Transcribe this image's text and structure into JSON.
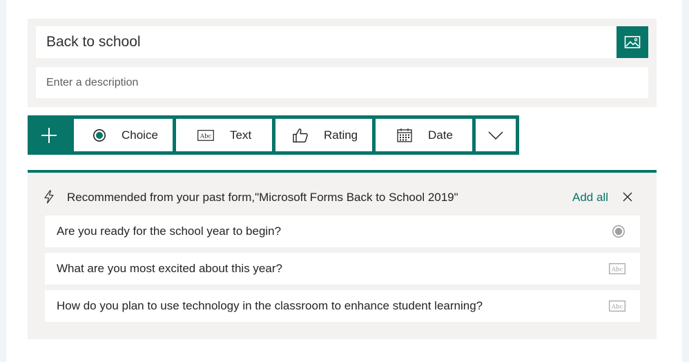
{
  "form": {
    "title": "Back to school",
    "description_placeholder": "Enter a description"
  },
  "toolbar": {
    "buttons": [
      {
        "label": "Choice",
        "icon": "radio-icon"
      },
      {
        "label": "Text",
        "icon": "abc-text-icon"
      },
      {
        "label": "Rating",
        "icon": "thumbs-up-icon"
      },
      {
        "label": "Date",
        "icon": "calendar-icon"
      }
    ]
  },
  "recommendations": {
    "header_text": "Recommended from your past form,\"Microsoft Forms Back to School 2019\"",
    "add_all_label": "Add all",
    "items": [
      {
        "text": "Are you ready for the school year to begin?",
        "type_icon": "radio-icon"
      },
      {
        "text": "What are you most excited about this year?",
        "type_icon": "abc-text-icon"
      },
      {
        "text": "How do you plan to use technology in the classroom to enhance student learning?",
        "type_icon": "abc-text-icon"
      }
    ]
  },
  "colors": {
    "accent": "#077568",
    "panel_bg": "#f3f2f1",
    "page_bg": "#eef4f7"
  }
}
